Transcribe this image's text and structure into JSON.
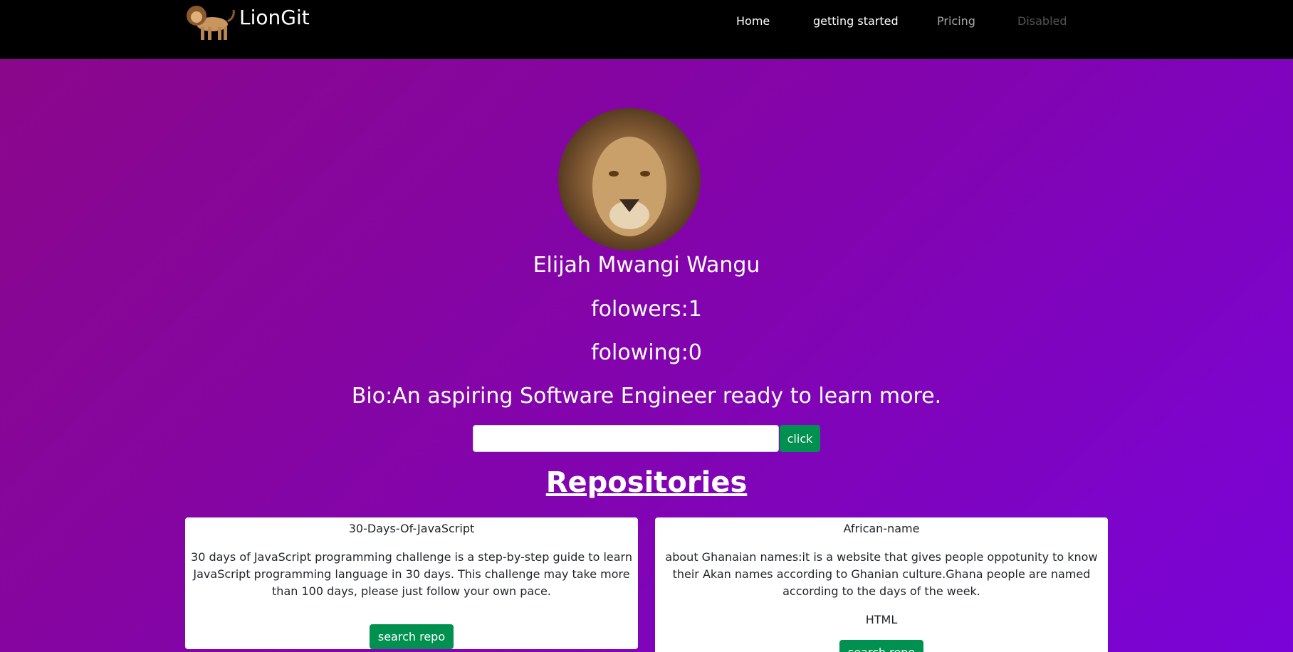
{
  "navbar": {
    "brand": "LionGit",
    "links": [
      "Home",
      "getting started",
      "Pricing",
      "Disabled"
    ]
  },
  "profile": {
    "name": "Elijah Mwangi Wangu",
    "followers": "folowers:1",
    "following": "folowing:0",
    "bio": "Bio:An aspiring Software Engineer ready to learn more."
  },
  "search": {
    "value": "",
    "button": "click"
  },
  "repos_heading": "Repositories",
  "repos": [
    {
      "name": "30-Days-Of-JavaScript",
      "description": "30 days of JavaScript programming challenge is a step-by-step guide to learn JavaScript programming language in 30 days. This challenge may take more than 100 days, please just follow your own pace.",
      "language": "",
      "button": "search repo"
    },
    {
      "name": "African-name",
      "description": "about Ghanaian names:it is a website that gives people oppotunity to know their Akan names according to Ghanian culture.Ghana people are named according to the days of the week.",
      "language": "HTML",
      "button": "search repo"
    }
  ],
  "colors": {
    "navbar": "#000000",
    "accent_green": "#009150",
    "gradient_start": "#8b0788",
    "gradient_end": "#7a04d8"
  }
}
